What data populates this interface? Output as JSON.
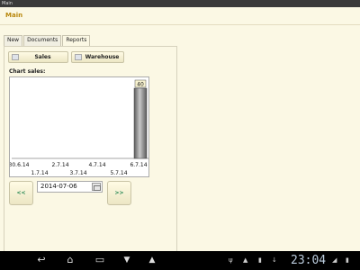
{
  "window": {
    "title": "Main"
  },
  "app": {
    "title": "Main"
  },
  "tabs": [
    {
      "label": "New",
      "active": false
    },
    {
      "label": "Documents",
      "active": false
    },
    {
      "label": "Reports",
      "active": true
    }
  ],
  "toolbar": {
    "sales_label": "Sales",
    "warehouse_label": "Warehouse"
  },
  "section": {
    "chart_label": "Chart sales:"
  },
  "chart_data": {
    "type": "bar",
    "title": "",
    "xlabel": "",
    "ylabel": "",
    "x_tick_labels_top": [
      "30.6.14",
      "2.7.14",
      "4.7.14",
      "6.7.14"
    ],
    "x_tick_labels_bottom": [
      "1.7.14",
      "3.7.14",
      "5.7.14"
    ],
    "categories": [
      "30.6.14",
      "1.7.14",
      "2.7.14",
      "3.7.14",
      "4.7.14",
      "5.7.14",
      "6.7.14"
    ],
    "values": [
      0,
      0,
      0,
      0,
      0,
      0,
      40
    ],
    "data_labels": {
      "6.7.14": "40"
    },
    "ylim": [
      0,
      40
    ],
    "grid": false,
    "bar_color": "#808080"
  },
  "nav": {
    "prev_label": "<<",
    "next_label": ">>"
  },
  "date": {
    "value": "2014-07-06"
  },
  "status_bar": {
    "clock": "23:04"
  },
  "colors": {
    "background": "#fbf8e4",
    "accent_title": "#b8860b",
    "nav_arrow": "#2e8b57"
  }
}
